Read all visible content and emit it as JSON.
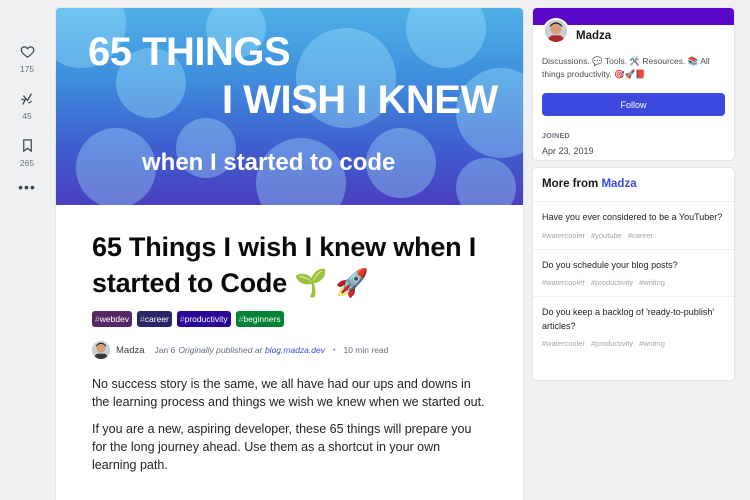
{
  "reactions": {
    "likes": "175",
    "unicorns": "45",
    "saves": "265"
  },
  "cover": {
    "line1": "65 THINGS",
    "line2": "I WISH I KNEW",
    "line3": "when I started to code"
  },
  "article": {
    "title": "65 Things I wish I knew when I started to Code 🌱 🚀",
    "tags": [
      {
        "label": "webdev",
        "color": "#562765"
      },
      {
        "label": "career",
        "color": "#2a2566"
      },
      {
        "label": "productivity",
        "color": "#2a0798"
      },
      {
        "label": "beginners",
        "color": "#008335"
      }
    ],
    "author": "Madza",
    "date": "Jan 6",
    "published_text": "Originally published at",
    "published_link": "blog.madza.dev",
    "separator": "・",
    "read_time": "10 min read",
    "paragraphs": [
      "No success story is the same, we all have had our ups and downs in the learning process and things we wish we knew when we started out.",
      "If you are a new, aspiring developer, these 65 things will prepare you for the long journey ahead. Use them as a shortcut in your own learning path."
    ]
  },
  "profile": {
    "name": "Madza",
    "summary": "Discussions. 💬 Tools. 🛠️ Resources. 📚 All things productivity. 🎯🚀📕",
    "follow_label": "Follow",
    "joined_label": "JOINED",
    "joined_date": "Apr 23, 2019",
    "band_color": "#5b07c9"
  },
  "more_from": {
    "prefix": "More from",
    "name": "Madza",
    "items": [
      {
        "title": "Have you ever considered to be a YouTuber?",
        "tags": [
          "#watercooler",
          "#youtube",
          "#career"
        ]
      },
      {
        "title": "Do you schedule your blog posts?",
        "tags": [
          "#watercooler",
          "#productivity",
          "#writing"
        ]
      },
      {
        "title": "Do you keep a backlog of 'ready-to-publish' articles?",
        "tags": [
          "#watercooler",
          "#productivity",
          "#writing"
        ]
      }
    ]
  },
  "colors": {
    "accent": "#3b49df",
    "background": "#eef0f1"
  }
}
